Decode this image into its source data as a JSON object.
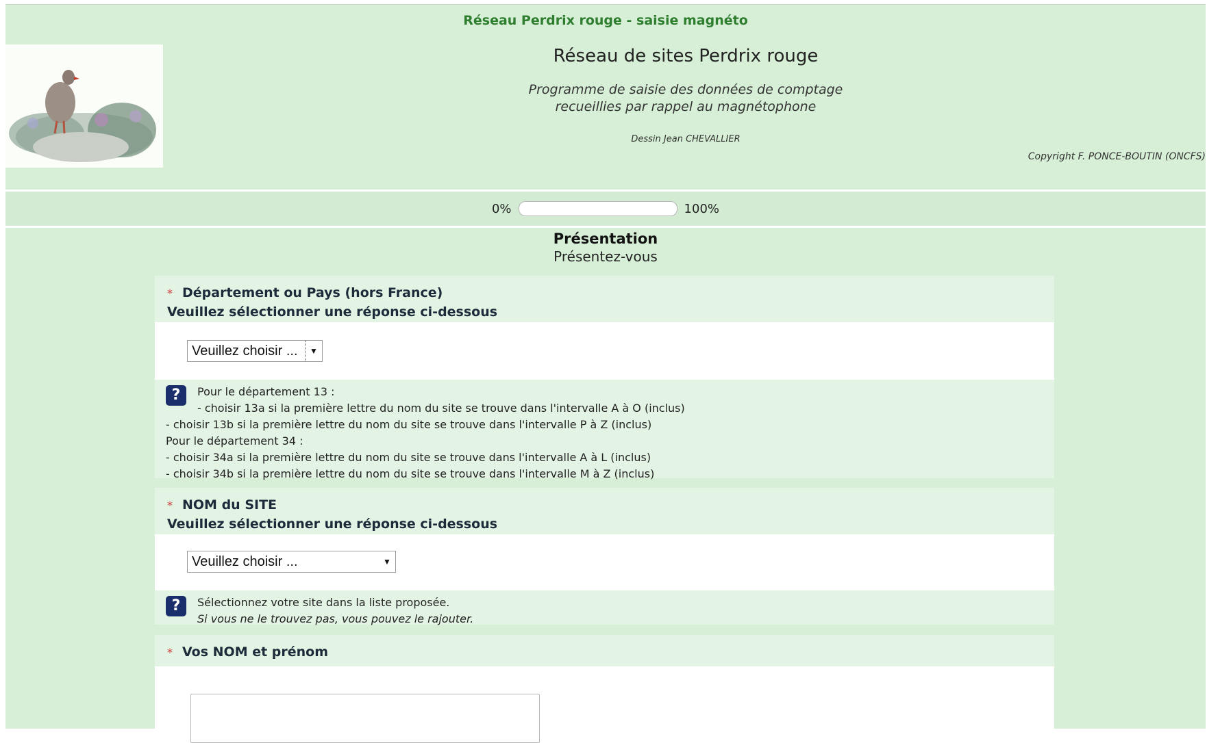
{
  "site_title": "Réseau Perdrix rouge - saisie magnéto",
  "header": {
    "title": "Réseau de sites Perdrix rouge",
    "subtitle_line1": "Programme de saisie des données de comptage",
    "subtitle_line2": "recueillies par rappel au magnétophone",
    "credit": "Dessin Jean CHEVALLIER",
    "copyright": "Copyright F. PONCE-BOUTIN (ONCFS)"
  },
  "progress": {
    "label_start": "0%",
    "label_end": "100%",
    "value": 0
  },
  "group": {
    "title": "Présentation",
    "description": "Présentez-vous"
  },
  "questions": [
    {
      "mandatory": "*",
      "text": "Département ou Pays (hors France)",
      "help": "Veuillez sélectionner une réponse ci-dessous",
      "select_value": "Veuillez choisir ...",
      "tips": [
        "Pour le département 13 :",
        "- choisir 13a si la première lettre du nom du site se trouve dans l'intervalle A à O (inclus)",
        "- choisir 13b si la première lettre du nom du site se trouve dans l'intervalle P à Z (inclus)",
        "Pour le département 34 :",
        "- choisir 34a si la première lettre du nom du site se trouve dans l'intervalle A à L (inclus)",
        "- choisir 34b si la première lettre du nom du site se trouve dans l'intervalle M à Z (inclus)"
      ]
    },
    {
      "mandatory": "*",
      "text": "NOM du SITE",
      "help": "Veuillez sélectionner une réponse ci-dessous",
      "select_value": "Veuillez choisir ...",
      "tips": [
        "Sélectionnez votre site dans la liste proposée.",
        "Si vous ne le trouvez pas, vous pouvez le rajouter."
      ]
    },
    {
      "mandatory": "*",
      "text": "Vos NOM et prénom",
      "input_value": ""
    }
  ],
  "icons": {
    "help": "question-mark-icon",
    "select_arrow": "chevron-down-icon"
  },
  "colors": {
    "page_bg": "#d6efd6",
    "site_title": "#2f7d2f",
    "mandatory": "#d23b3b",
    "help_icon": "#1a2e6b"
  }
}
